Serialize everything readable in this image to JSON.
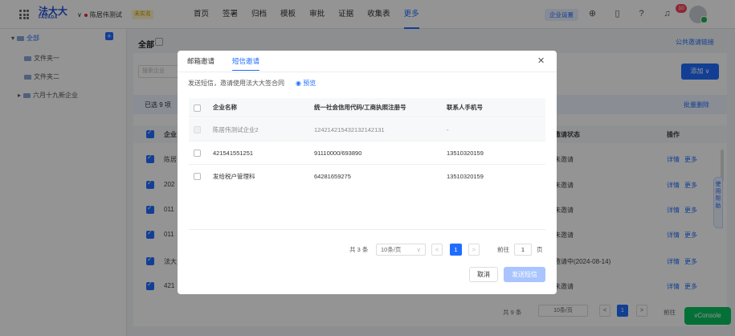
{
  "header": {
    "logo_cn": "法大大",
    "logo_en": "FADADA",
    "company": "陈居伟测试",
    "company_badge": "未实名",
    "nav": [
      "首页",
      "签署",
      "归档",
      "模板",
      "审批",
      "证据",
      "收集表",
      "更多"
    ],
    "active_nav_index": 7,
    "settings_label": "企业设置",
    "notification_count": "10"
  },
  "sidebar": {
    "root": "全部",
    "items": [
      "文件夹一",
      "文件夹二",
      "六月十九新企业"
    ]
  },
  "background": {
    "title": "全部",
    "public_link": "公共邀请链接",
    "search_placeholder": "搜索企业",
    "add_button": "添加 ∨",
    "selected_text": "已选 9 项",
    "batch_delete": "批量删除",
    "col_company": "企业",
    "col_status": "邀请状态",
    "col_action": "操作",
    "rows": [
      {
        "name": "陈居",
        "status": "未邀请",
        "edit": "详情",
        "more": "更多"
      },
      {
        "name": "202",
        "status": "未邀请",
        "edit": "详情",
        "more": "更多"
      },
      {
        "name": "011",
        "status": "未邀请",
        "edit": "详情",
        "more": "更多"
      },
      {
        "name": "011",
        "status": "未邀请",
        "edit": "详情",
        "more": "更多"
      },
      {
        "name": "法大",
        "status": "邀请中(2024-08-14)",
        "edit": "详情",
        "more": "更多"
      },
      {
        "name": "421",
        "status": "未邀请",
        "edit": "详情",
        "more": "更多"
      }
    ],
    "pagination": {
      "total": "共 9 条",
      "size": "10条/页",
      "current": "1",
      "goto": "前往"
    },
    "help_label": "使用帮助",
    "vconsole": "vConsole"
  },
  "modal": {
    "tabs": [
      "邮箱邀请",
      "短信邀请"
    ],
    "active_tab_index": 1,
    "hint": "发送短信，邀请使用法大大签合同",
    "preview": "预览",
    "columns": [
      "企业名称",
      "统一社会信用代码/工商执照注册号",
      "联系人手机号"
    ],
    "rows": [
      {
        "name": "陈居伟测试企业2",
        "code": "124214215432132142131",
        "phone": "-",
        "disabled": true
      },
      {
        "name": "421541551251",
        "code": "91110000/693890",
        "phone": "13510320159",
        "disabled": false
      },
      {
        "name": "发给税户管理科",
        "code": "64281659275",
        "phone": "13510320159",
        "disabled": false
      }
    ],
    "pagination": {
      "total": "共 3 条",
      "size": "10条/页",
      "prev": "<",
      "current": "1",
      "next": ">",
      "goto": "前往",
      "page_value": "1",
      "page_unit": "页"
    },
    "cancel": "取消",
    "send": "发送短信"
  },
  "colors": {
    "accent": "#1f6dff",
    "vconsole": "#07c160"
  }
}
